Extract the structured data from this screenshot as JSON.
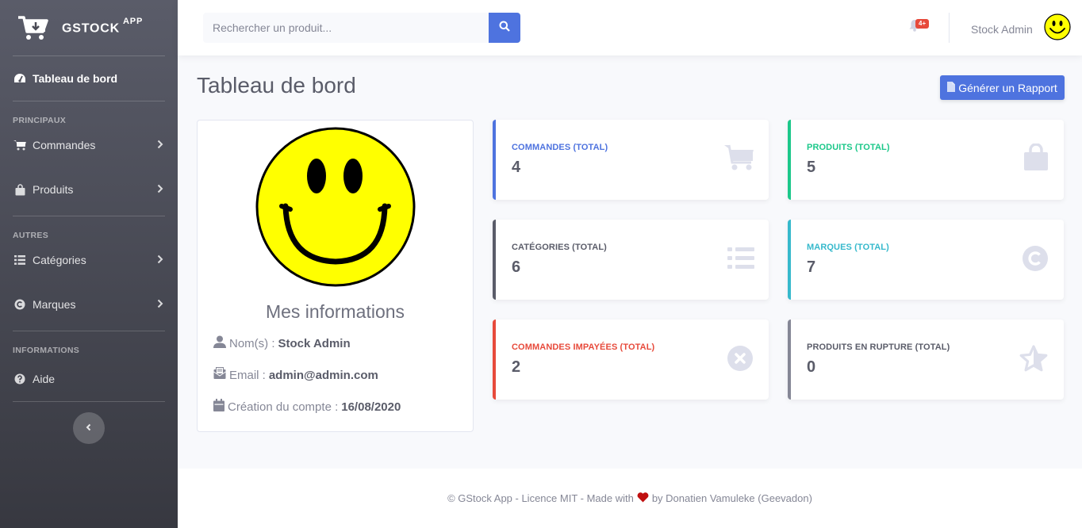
{
  "brand": {
    "name": "GSTOCK",
    "sup": "APP"
  },
  "sidebar": {
    "dashboard_label": "Tableau de bord",
    "heading_principaux": "PRINCIPAUX",
    "heading_autres": "AUTRES",
    "heading_informations": "INFORMATIONS",
    "items": [
      {
        "label": "Commandes",
        "icon": "cart-icon"
      },
      {
        "label": "Produits",
        "icon": "bag-icon"
      },
      {
        "label": "Catégories",
        "icon": "list-icon"
      },
      {
        "label": "Marques",
        "icon": "copyright-icon"
      },
      {
        "label": "Aide",
        "icon": "question-icon"
      }
    ]
  },
  "topbar": {
    "search_placeholder": "Rechercher un produit...",
    "notification_badge": "4+",
    "user_name": "Stock Admin"
  },
  "main": {
    "title": "Tableau de bord",
    "report_button": "Générer un Rapport"
  },
  "profile": {
    "title": "Mes informations",
    "name_label": "Nom(s) :",
    "name_value": "Stock Admin",
    "email_label": "Email :",
    "email_value": "admin@admin.com",
    "created_label": "Création du compte :",
    "created_value": "16/08/2020"
  },
  "stats": [
    {
      "label": "COMMANDES (TOTAL)",
      "value": "4",
      "color": "#4e73df",
      "icon": "cart-icon"
    },
    {
      "label": "PRODUITS (TOTAL)",
      "value": "5",
      "color": "#1cc88a",
      "icon": "bag-icon"
    },
    {
      "label": "CATÉGORIES (TOTAL)",
      "value": "6",
      "color": "#5a5c69",
      "icon": "list-icon"
    },
    {
      "label": "MARQUES (TOTAL)",
      "value": "7",
      "color": "#36b9cc",
      "icon": "copyright-icon"
    },
    {
      "label": "COMMANDES IMPAYÉES (TOTAL)",
      "value": "2",
      "color": "#e74a3b",
      "icon": "times-circle-icon"
    },
    {
      "label": "PRODUITS EN RUPTURE (TOTAL)",
      "value": "0",
      "color": "#858796",
      "icon": "star-icon"
    }
  ],
  "footer": {
    "prefix": "© GStock App - Licence MIT - Made with",
    "suffix": "by Donatien Vamuleke (Geevadon)"
  }
}
